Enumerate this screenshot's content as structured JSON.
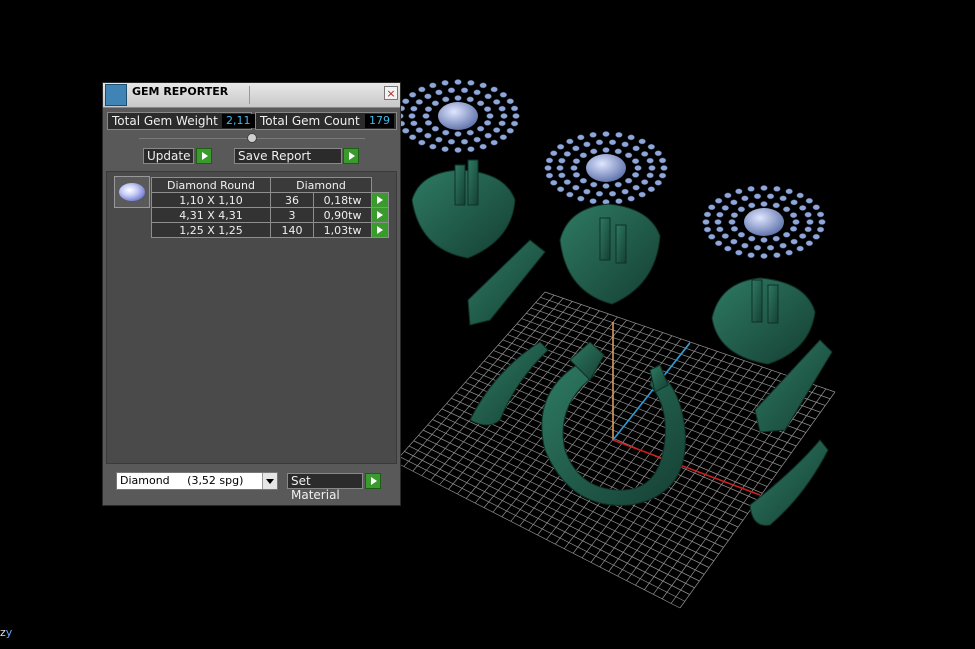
{
  "panel": {
    "title": "GEM REPORTER",
    "close": "×",
    "total_weight_label": "Total Gem Weight",
    "total_weight_value": "2,11",
    "total_count_label": "Total Gem Count",
    "total_count_value": "179",
    "update_label": "Update",
    "save_label": "Save Report",
    "table": {
      "headers": [
        "Diamond Round",
        "Diamond"
      ],
      "rows": [
        {
          "size": "1,10 X 1,10",
          "count": "36",
          "weight": "0,18tw"
        },
        {
          "size": "4,31 X 4,31",
          "count": "3",
          "weight": "0,90tw"
        },
        {
          "size": "1,25 X 1,25",
          "count": "140",
          "weight": "1,03tw"
        }
      ]
    },
    "material": "Diamond     (3,52 spg)",
    "set_material_label": "Set Material"
  },
  "viewport": {
    "axis_z": "z",
    "axis_y": "y",
    "colors": {
      "metal": "#1f5a48",
      "gem": "#8fa6d6",
      "grid": "#b8b8b8",
      "axis_x": "#d02020",
      "axis_y": "#2b9ad8",
      "axis_z": "#e8a060"
    }
  }
}
